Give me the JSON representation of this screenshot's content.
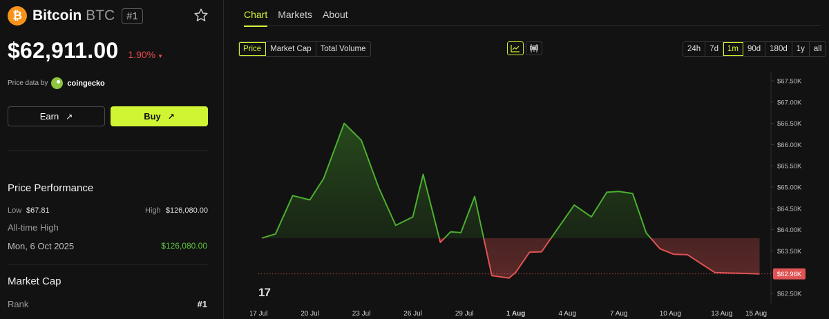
{
  "coin": {
    "name": "Bitcoin",
    "symbol": "BTC",
    "rank_badge": "#1",
    "logo_glyph": "₿",
    "price": "$62,911.00",
    "change": "1.90%",
    "change_direction": "down"
  },
  "provider": {
    "label": "Price data by",
    "name": "coingecko"
  },
  "actions": {
    "earn_label": "Earn",
    "buy_label": "Buy"
  },
  "performance": {
    "title": "Price Performance",
    "low_label": "Low",
    "low_value": "$67.81",
    "high_label": "High",
    "high_value": "$126,080.00",
    "ath_label": "All-time High",
    "ath_date": "Mon, 6 Oct 2025",
    "ath_value": "$126,080.00"
  },
  "market_cap": {
    "title": "Market Cap",
    "rank_label": "Rank",
    "rank_value": "#1"
  },
  "tabs": [
    {
      "label": "Chart",
      "active": true
    },
    {
      "label": "Markets",
      "active": false
    },
    {
      "label": "About",
      "active": false
    }
  ],
  "metric_options": [
    {
      "label": "Price",
      "active": true
    },
    {
      "label": "Market Cap",
      "active": false
    },
    {
      "label": "Total Volume",
      "active": false
    }
  ],
  "chart_types": [
    {
      "icon": "line-chart-icon",
      "active": true
    },
    {
      "icon": "candlestick-icon",
      "active": false
    }
  ],
  "ranges": [
    {
      "label": "24h",
      "active": false
    },
    {
      "label": "7d",
      "active": false
    },
    {
      "label": "1m",
      "active": true
    },
    {
      "label": "90d",
      "active": false
    },
    {
      "label": "180d",
      "active": false
    },
    {
      "label": "1y",
      "active": false
    },
    {
      "label": "all",
      "active": false
    }
  ],
  "colors": {
    "accent": "#d0f533",
    "up": "#4caf2e",
    "down": "#e05353",
    "bitcoin": "#f7931a"
  },
  "chart_data": {
    "type": "line",
    "x_tick_labels": [
      "17 Jul",
      "20 Jul",
      "23 Jul",
      "26 Jul",
      "29 Jul",
      "1 Aug",
      "4 Aug",
      "7 Aug",
      "10 Aug",
      "13 Aug",
      "15 Aug"
    ],
    "y_tick_labels": [
      "$67.50K",
      "$67.00K",
      "$66.50K",
      "$66.00K",
      "$65.50K",
      "$65.00K",
      "$64.50K",
      "$64.00K",
      "$63.50K",
      "$63.00K",
      "$62.50K"
    ],
    "ylim": [
      62500,
      67500
    ],
    "y_ticks": [
      67500,
      67000,
      66500,
      66000,
      65500,
      65000,
      64500,
      64000,
      63500,
      63000,
      62500
    ],
    "baseline": 63800,
    "current_label": "$62.96K",
    "current_value": 62960,
    "x_days": [
      0,
      3,
      6,
      9,
      12,
      15,
      18,
      21,
      24,
      27,
      29
    ],
    "x_labels_bold": [
      false,
      false,
      false,
      false,
      false,
      true,
      false,
      false,
      false,
      false,
      false
    ],
    "x": [
      0.2,
      1,
      2,
      3,
      3.8,
      5,
      6,
      7,
      8,
      9,
      9.6,
      10.6,
      11.2,
      11.8,
      12.6,
      13.6,
      14.6,
      15,
      15.8,
      16.5,
      17.4,
      18.4,
      19.4,
      20.3,
      21,
      21.8,
      22.6,
      23.4,
      24.2,
      25,
      25.8,
      26.6,
      27.4,
      28.4,
      29.2
    ],
    "y": [
      63800,
      63900,
      64800,
      64700,
      65200,
      66500,
      66100,
      65000,
      64100,
      64300,
      65300,
      63700,
      63950,
      63930,
      64780,
      62920,
      62860,
      63000,
      63470,
      63480,
      64000,
      64580,
      64300,
      64880,
      64900,
      64850,
      63920,
      63550,
      63420,
      63410,
      63200,
      62990,
      62980,
      62970,
      62960
    ]
  }
}
